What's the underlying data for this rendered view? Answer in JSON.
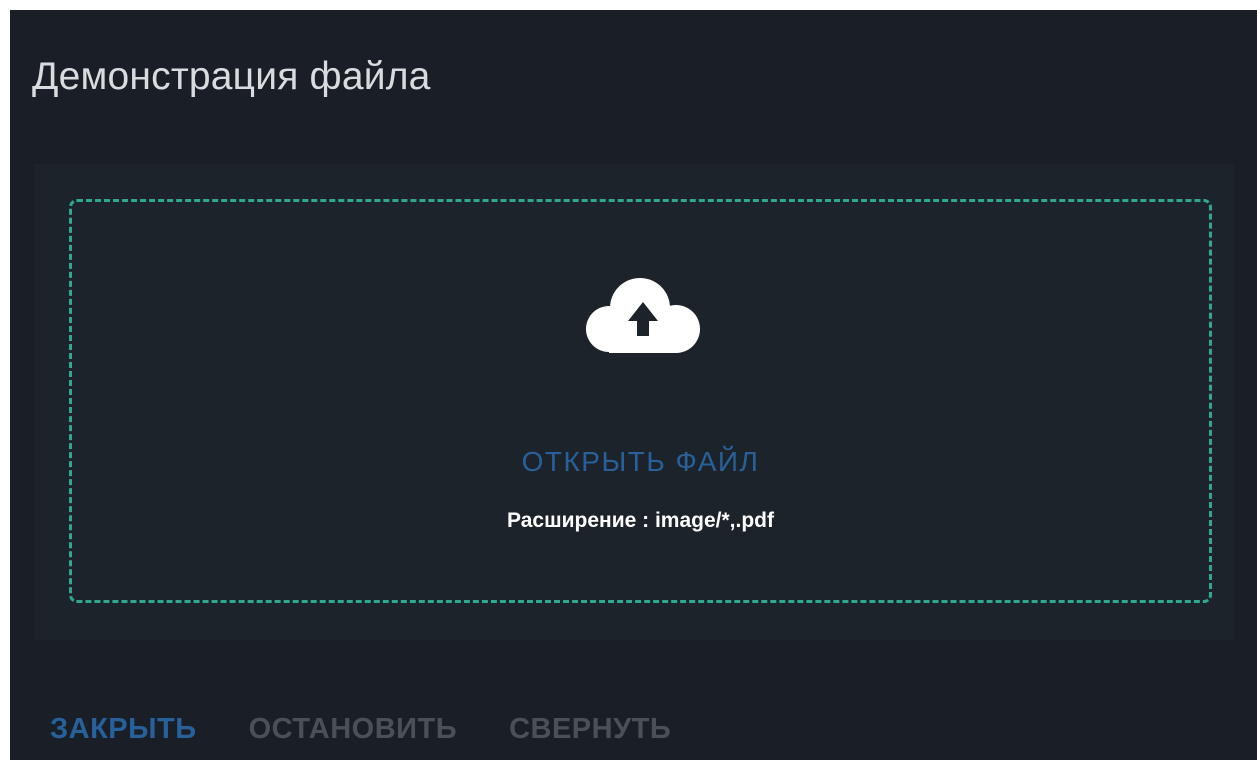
{
  "dialog": {
    "title": "Демонстрация файла"
  },
  "dropzone": {
    "icon": "cloud-upload-icon",
    "open_label": "ОТКРЫТЬ ФАЙЛ",
    "extensions_text": "Расширение : image/*,.pdf",
    "border_color": "#2fa88d"
  },
  "actions": {
    "close_label": "ЗАКРЫТЬ",
    "stop_label": "ОСТАНОВИТЬ",
    "collapse_label": "СВЕРНУТЬ"
  },
  "colors": {
    "background": "#1a1f27",
    "accent": "#27609a",
    "disabled": "#4b5058"
  }
}
